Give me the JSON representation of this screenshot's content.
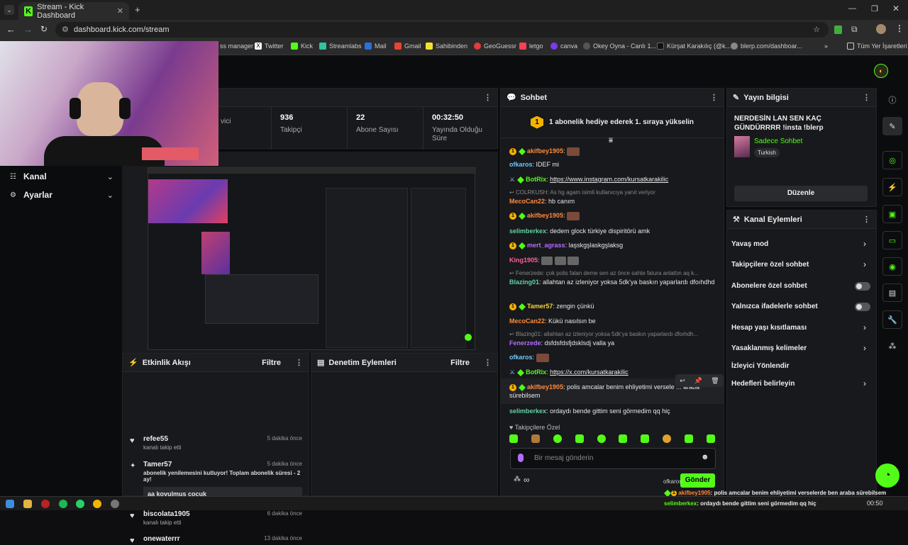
{
  "browser": {
    "tab_title": "Stream - Kick Dashboard",
    "url": "dashboard.kick.com/stream",
    "bookmarks": [
      "ss manager",
      "Twitter",
      "Kick",
      "Streamlabs",
      "Mail",
      "Gmail",
      "Sahibinden",
      "GeoGuessr",
      "letgo",
      "canva",
      "Okey Oyna - Canlı 1...",
      "Kürşat Karakılıç (@k...",
      "blerp.com/dashboar..."
    ],
    "all_bookmarks": "Tüm Yer İşaretleri"
  },
  "sidebar": {
    "kanal": "Kanal",
    "ayarlar": "Ayarlar"
  },
  "stats": [
    {
      "value": "",
      "label": "vici"
    },
    {
      "value": "936",
      "label": "Takipçi"
    },
    {
      "value": "22",
      "label": "Abone Sayısı"
    },
    {
      "value": "00:32:50",
      "label": "Yayında Olduğu Süre"
    }
  ],
  "activity": {
    "title": "Etkinlik Akışı",
    "filter": "Filtre",
    "events": [
      {
        "name": "refee55",
        "sub": "kanalı takip etti",
        "time": "5 dakika önce"
      },
      {
        "name": "Tamer57",
        "sub": "abonelik yenilemesini kutluyor! Toplam abonelik süresi - 2 ay!",
        "time": "5 dakika önce",
        "msg": "aa kovulmuş çocuk"
      },
      {
        "name": "biscolata1905",
        "sub": "kanalı takip etti",
        "time": "6 dakika önce"
      },
      {
        "name": "onewaterrr",
        "sub": "",
        "time": "13 dakika önce"
      }
    ]
  },
  "moderation": {
    "title": "Denetim Eylemleri",
    "filter": "Filtre"
  },
  "chat": {
    "title": "Sohbet",
    "pinned": "1 abonelik hediye ederek 1. sıraya yükselin",
    "lines": [
      {
        "user": "akifbey1905",
        "text": ""
      },
      {
        "user": "ofkaros",
        "text": "IDEF mi"
      },
      {
        "user": "BotRix",
        "text": "https://www.instagram.com/kursatkarakilic"
      },
      {
        "reply": "COLRKUSH: As hg agam isimli kullanıcıya yanıt veriyor"
      },
      {
        "user": "MecoCan22",
        "text": "hb canım"
      },
      {
        "user": "akifbey1905",
        "text": ""
      },
      {
        "user": "selimberkex",
        "text": "dedem glock türkiye dispiritörü amk"
      },
      {
        "user": "mert_agrass",
        "text": "laşskgşlaskgşlaksg"
      },
      {
        "user": "King1905",
        "text": ""
      },
      {
        "reply": "Fenerzede: çok polis falan deme sen az önce sahte fatura anlattın aq k..."
      },
      {
        "user": "Blazing01",
        "text": "allahtan az izleniyor yoksa 5dk'ya baskın yaparlardı dfoıhdhd"
      },
      {
        "user": "Tamer57",
        "text": "zengin çünkü"
      },
      {
        "user": "MecoCan22",
        "text": "Kükü nasılsın be"
      },
      {
        "reply": "Blazing01: allahtan az izleniyor yoksa 5dk'ya baskın yaparlardı dfoıhdh..."
      },
      {
        "user": "Fenerzede",
        "text": "dsfdsfdsfjdsklsdj valla ya"
      },
      {
        "user": "ofkaros",
        "text": ""
      },
      {
        "user": "BotRix",
        "text": "https://x.com/kursatkarakilic"
      },
      {
        "user": "akifbey1905",
        "text": "polis amcalar benim ehliyetimi versele ... araba sürebilsem"
      },
      {
        "user": "selimberkex",
        "text": "ordaydı bende gittim seni görmedim qq hiç"
      }
    ],
    "follower_only": "Takipçilere Özel",
    "input_placeholder": "Bir mesaj gönderin",
    "send": "Gönder"
  },
  "stream_info": {
    "title": "Yayın bilgisi",
    "stream_title": "NERDESİN LAN SEN KAÇ GÜNDÜRRRR !insta !blerp",
    "category": "Sadece Sohbet",
    "language": "Turkish",
    "edit": "Düzenle"
  },
  "channel_actions": {
    "title": "Kanal Eylemleri",
    "items": [
      "Yavaş mod",
      "Takipçilere özel sohbet",
      "Abonelere özel sohbet",
      "Yalnızca ifadelerle sohbet",
      "Hesap yaşı kısıtlaması",
      "Yasaklanmış kelimeler",
      "İzleyici Yönlendir",
      "Hedefleri belirleyin"
    ]
  },
  "overlay": {
    "line1_user": "akifbey1905",
    "line1_text": ": polis amcalar benim ehliyetimi verselerde ben araba sürebilsem",
    "line2_user": "selimberkex",
    "line2_text": ": ordaydı bende gittim seni görmedim qq hiç",
    "small_user": "ofkaros"
  },
  "taskbar": {
    "time": "00:50"
  },
  "colors": {
    "accent": "#53fc18",
    "bg": "#0b0c0e",
    "panel": "#18191c"
  }
}
